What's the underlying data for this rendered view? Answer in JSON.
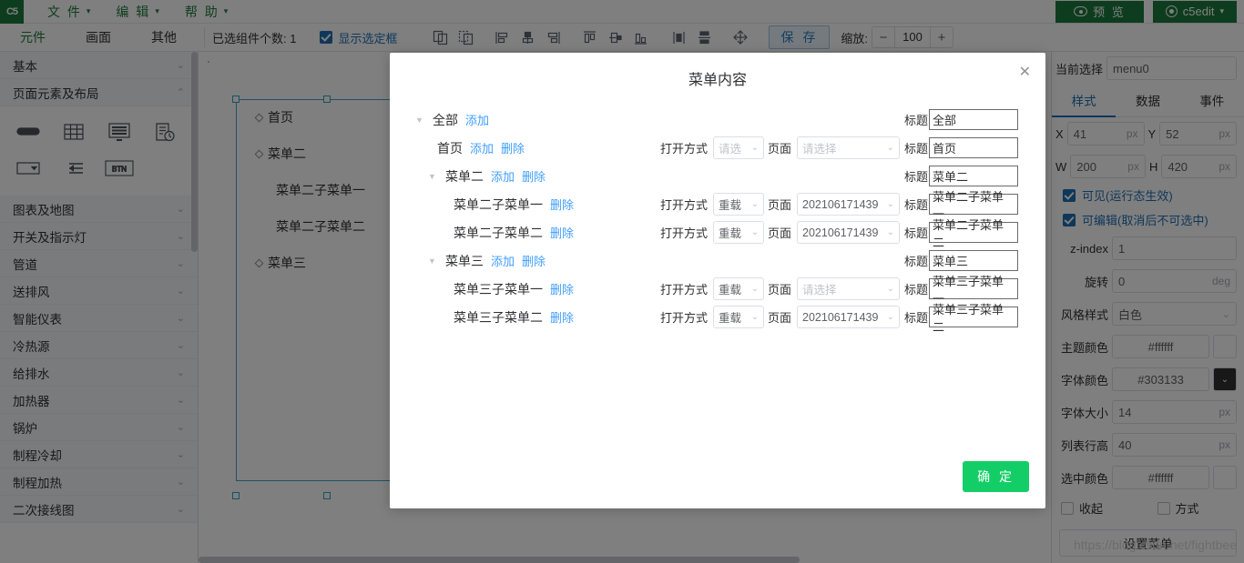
{
  "menubar": {
    "logo": "C5",
    "items": [
      {
        "label": "文 件",
        "icon": "chevron-down-icon"
      },
      {
        "label": "编 辑",
        "icon": "chevron-down-icon"
      },
      {
        "label": "帮 助",
        "icon": "chevron-down-icon"
      }
    ],
    "preview_button": "预 览",
    "user_button": "c5edit"
  },
  "toolbar": {
    "tabs": [
      {
        "label": "元件",
        "active": true
      },
      {
        "label": "画面",
        "active": false
      },
      {
        "label": "其他",
        "active": false
      }
    ],
    "selected_count_label": "已选组件个数: 1",
    "show_selection_label": "显示选定框",
    "show_selection_checked": true,
    "icons": [
      "group-icon",
      "ungroup-icon",
      "align-left-icon",
      "align-center-icon",
      "align-right-icon",
      "align-top-icon",
      "align-middle-icon",
      "align-bottom-icon",
      "distribute-horizontal-icon",
      "distribute-vertical-icon",
      "move-icon"
    ],
    "save_label": "保 存",
    "zoom_label": "缩放:",
    "zoom_minus": "−",
    "zoom_value": "100",
    "zoom_plus": "+"
  },
  "left_panel": {
    "sections": [
      {
        "label": "基本",
        "open": false
      },
      {
        "label": "页面元素及布局",
        "open": true
      },
      {
        "label": "图表及地图",
        "open": false
      },
      {
        "label": "开关及指示灯",
        "open": false
      },
      {
        "label": "管道",
        "open": false
      },
      {
        "label": "送排风",
        "open": false
      },
      {
        "label": "智能仪表",
        "open": false
      },
      {
        "label": "冷热源",
        "open": false
      },
      {
        "label": "给排水",
        "open": false
      },
      {
        "label": "加热器",
        "open": false
      },
      {
        "label": "锅炉",
        "open": false
      },
      {
        "label": "制程冷却",
        "open": false
      },
      {
        "label": "制程加热",
        "open": false
      },
      {
        "label": "二次接线图",
        "open": false
      }
    ],
    "palette_icons": [
      "input-field-icon",
      "table-icon",
      "list-panel-icon",
      "report-clock-icon",
      "select-dropdown-icon",
      "menu-collapse-icon",
      "button-icon"
    ],
    "button_icon_label": "BTN"
  },
  "canvas": {
    "component_name": "menu0",
    "menu_rows": [
      {
        "label": "首页",
        "level": 0,
        "chevron": ""
      },
      {
        "label": "菜单二",
        "level": 0,
        "chevron": "up"
      },
      {
        "label": "菜单二子菜单一",
        "level": 1,
        "chevron": ""
      },
      {
        "label": "菜单二子菜单二",
        "level": 1,
        "chevron": ""
      },
      {
        "label": "菜单三",
        "level": 0,
        "chevron": "down"
      }
    ]
  },
  "right_panel": {
    "current_select_label": "当前选择",
    "current_select_value": "menu0",
    "tabs": [
      {
        "label": "样式",
        "active": true
      },
      {
        "label": "数据",
        "active": false
      },
      {
        "label": "事件",
        "active": false
      }
    ],
    "fields": {
      "x_label": "X",
      "x_value": "41",
      "x_unit": "px",
      "y_label": "Y",
      "y_value": "52",
      "y_unit": "px",
      "w_label": "W",
      "w_value": "200",
      "w_unit": "px",
      "h_label": "H",
      "h_value": "420",
      "h_unit": "px",
      "visible_label": "可见(运行态生效)",
      "visible_checked": true,
      "editable_label": "可编辑(取消后不可选中)",
      "editable_checked": true,
      "zindex_label": "z-index",
      "zindex_value": "1",
      "rotate_label": "旋转",
      "rotate_value": "0",
      "rotate_unit": "deg",
      "gridstyle_label": "风格样式",
      "gridstyle_value": "白色",
      "themecolor_label": "主题颜色",
      "themecolor_value": "#ffffff",
      "fontcolor_label": "字体颜色",
      "fontcolor_value": "#303133",
      "fontsize_label": "字体大小",
      "fontsize_value": "14",
      "fontsize_unit": "px",
      "rowheight_label": "列表行高",
      "rowheight_value": "40",
      "rowheight_unit": "px",
      "selectedcolor_label": "选中颜色",
      "selectedcolor_value": "#ffffff",
      "collapse_label": "收起",
      "collapse_checked": false,
      "mode_label": "方式",
      "mode_checked": false,
      "set_menu_button": "设置菜单"
    }
  },
  "modal": {
    "title": "菜单内容",
    "close_icon": "close-icon",
    "confirm_button": "确 定",
    "labels": {
      "open_mode": "打开方式",
      "page": "页面",
      "title": "标题",
      "add": "添加",
      "delete": "删除"
    },
    "rows": [
      {
        "name": "全部",
        "indent": 0,
        "arrow": "down",
        "add": "添加",
        "del": null,
        "open_mode": null,
        "page": null,
        "title_value": "全部"
      },
      {
        "name": "首页",
        "indent": 1,
        "arrow": null,
        "add": "添加",
        "del": "删除",
        "open_mode": "请选",
        "open_mode_placeholder": true,
        "page": "请选择",
        "page_placeholder": true,
        "title_value": "首页"
      },
      {
        "name": "菜单二",
        "indent": 1,
        "arrow": "down",
        "add": "添加",
        "del": "删除",
        "open_mode": null,
        "page": null,
        "title_value": "菜单二"
      },
      {
        "name": "菜单二子菜单一",
        "indent": 2,
        "arrow": null,
        "add": null,
        "del": "删除",
        "open_mode": "重载",
        "open_mode_placeholder": false,
        "page": "202106171439",
        "page_placeholder": false,
        "title_value": "菜单二子菜单一"
      },
      {
        "name": "菜单二子菜单二",
        "indent": 2,
        "arrow": null,
        "add": null,
        "del": "删除",
        "open_mode": "重载",
        "open_mode_placeholder": false,
        "page": "202106171439",
        "page_placeholder": false,
        "title_value": "菜单二子菜单二"
      },
      {
        "name": "菜单三",
        "indent": 1,
        "arrow": "down",
        "add": "添加",
        "del": "删除",
        "open_mode": null,
        "page": null,
        "title_value": "菜单三"
      },
      {
        "name": "菜单三子菜单一",
        "indent": 2,
        "arrow": null,
        "add": null,
        "del": "删除",
        "open_mode": "重载",
        "open_mode_placeholder": false,
        "page": "请选择",
        "page_placeholder": true,
        "title_value": "菜单三子菜单一"
      },
      {
        "name": "菜单三子菜单二",
        "indent": 2,
        "arrow": null,
        "add": null,
        "del": "删除",
        "open_mode": "重载",
        "open_mode_placeholder": false,
        "page": "202106171439",
        "page_placeholder": false,
        "title_value": "菜单三子菜单二"
      }
    ]
  },
  "watermark": "https://blog.csdn.net/fightbee"
}
